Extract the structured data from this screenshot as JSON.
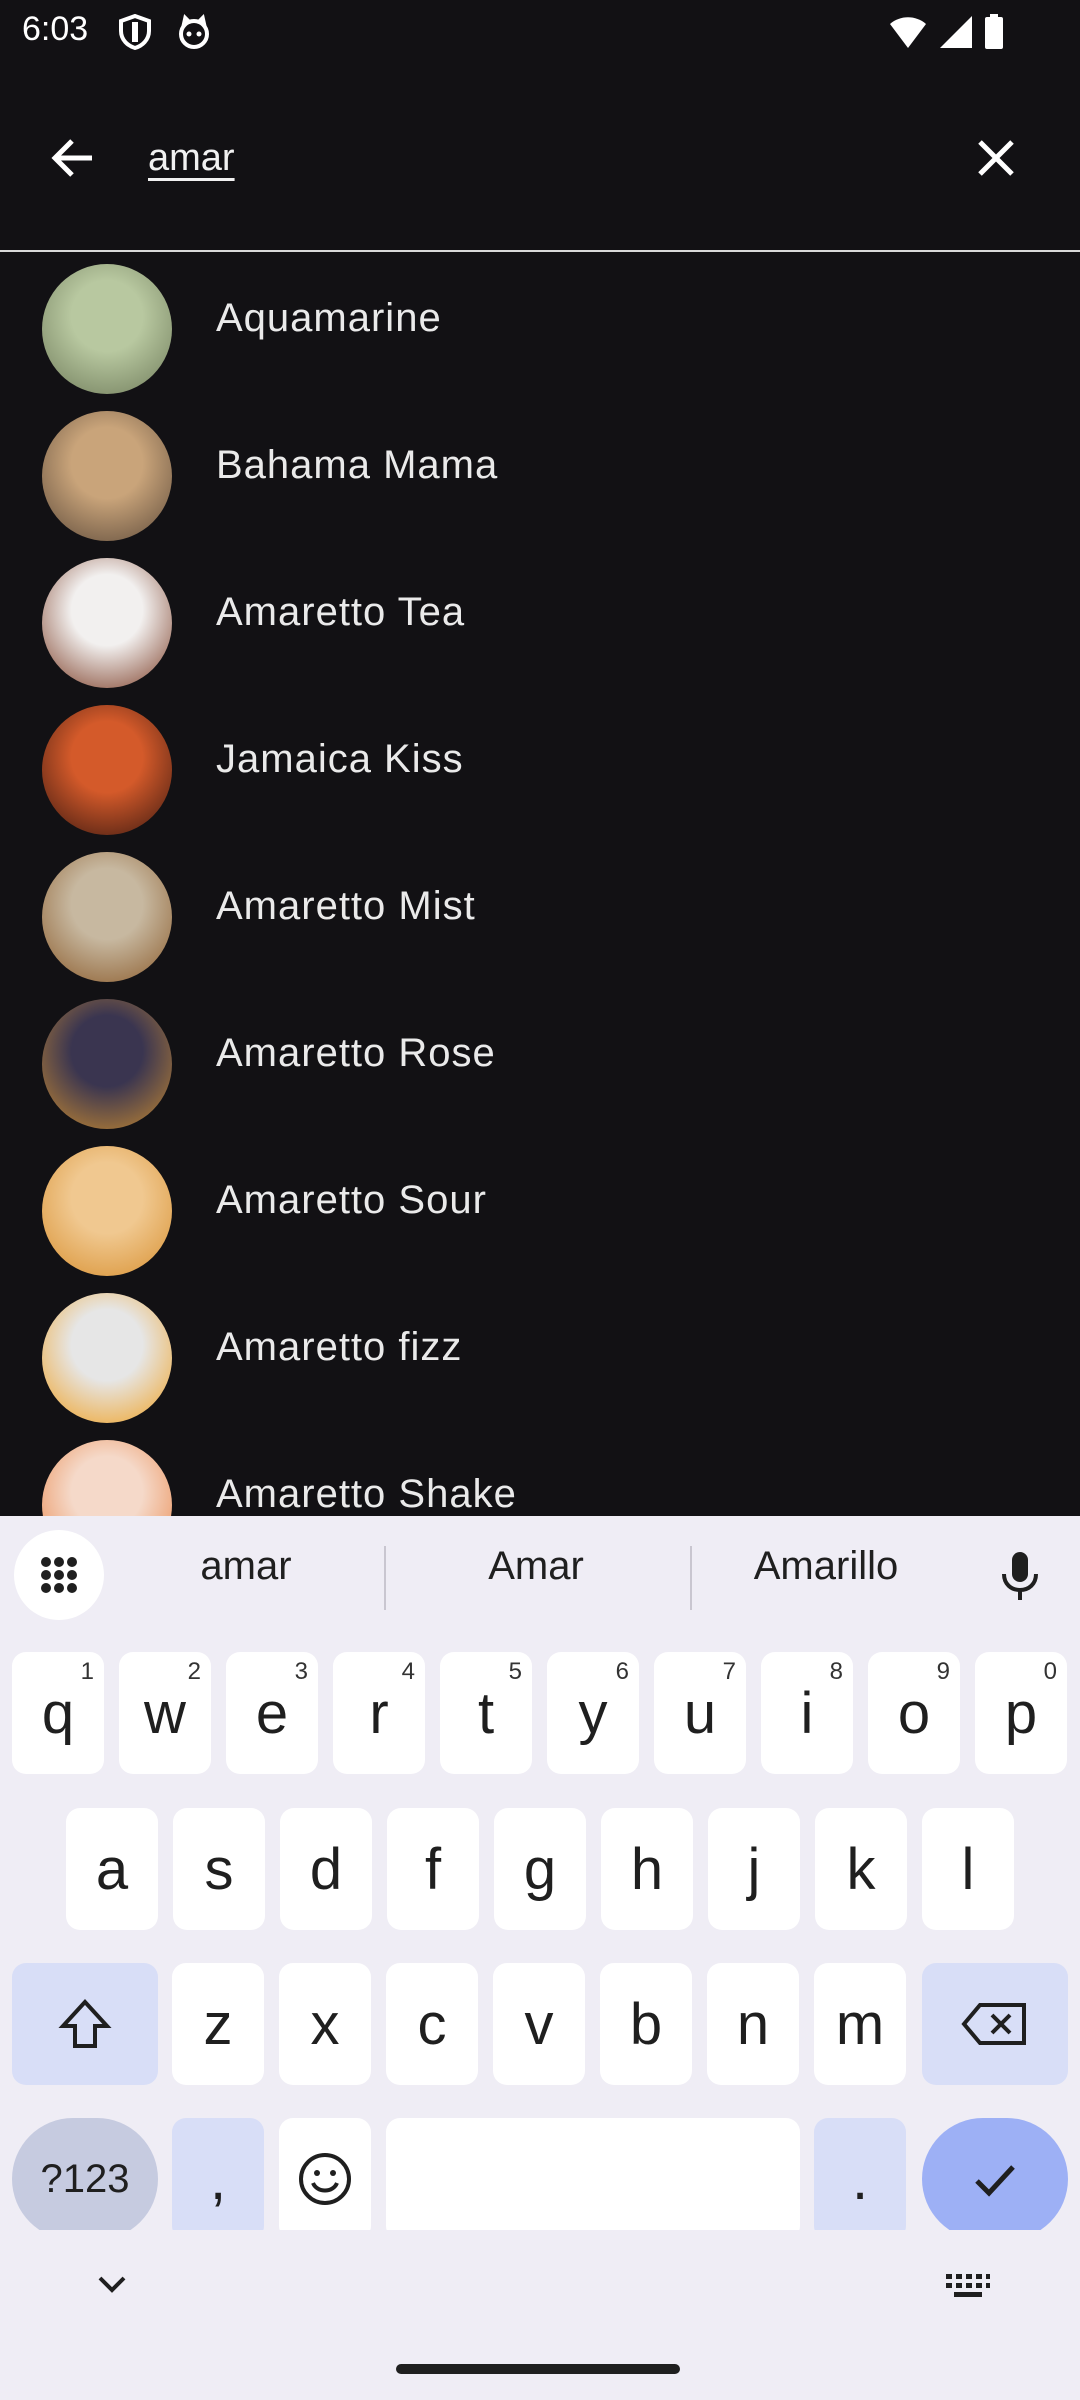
{
  "status_bar": {
    "time": "6:03",
    "icons": [
      "shield-icon",
      "cat-icon",
      "wifi-icon",
      "signal-icon",
      "battery-icon"
    ]
  },
  "search": {
    "query": "amar",
    "back_icon": "arrow-left-icon",
    "clear_icon": "close-icon"
  },
  "results": [
    {
      "name": "Aquamarine",
      "colors": [
        "#b8c8a0",
        "#6f7b5a"
      ]
    },
    {
      "name": "Bahama Mama",
      "colors": [
        "#c9a47a",
        "#5d4a3a"
      ]
    },
    {
      "name": "Amaretto Tea",
      "colors": [
        "#f2f0ef",
        "#7a3a23"
      ]
    },
    {
      "name": "Jamaica Kiss",
      "colors": [
        "#d45a2a",
        "#3a1810"
      ]
    },
    {
      "name": "Amaretto Mist",
      "colors": [
        "#c7b8a0",
        "#8a5a2a"
      ]
    },
    {
      "name": "Amaretto Rose",
      "colors": [
        "#3a3550",
        "#c78a30"
      ]
    },
    {
      "name": "Amaretto Sour",
      "colors": [
        "#f0c890",
        "#d89030"
      ]
    },
    {
      "name": "Amaretto fizz",
      "colors": [
        "#e6e6e6",
        "#f0a020"
      ]
    },
    {
      "name": "Amaretto Shake",
      "colors": [
        "#f5d9c9",
        "#e88040"
      ]
    }
  ],
  "keyboard": {
    "suggestions": [
      "amar",
      "Amar",
      "Amarillo"
    ],
    "row1": [
      {
        "k": "q",
        "h": "1"
      },
      {
        "k": "w",
        "h": "2"
      },
      {
        "k": "e",
        "h": "3"
      },
      {
        "k": "r",
        "h": "4"
      },
      {
        "k": "t",
        "h": "5"
      },
      {
        "k": "y",
        "h": "6"
      },
      {
        "k": "u",
        "h": "7"
      },
      {
        "k": "i",
        "h": "8"
      },
      {
        "k": "o",
        "h": "9"
      },
      {
        "k": "p",
        "h": "0"
      }
    ],
    "row2": [
      "a",
      "s",
      "d",
      "f",
      "g",
      "h",
      "j",
      "k",
      "l"
    ],
    "row3": [
      "z",
      "x",
      "c",
      "v",
      "b",
      "n",
      "m"
    ],
    "symbols_label": "?123",
    "comma": ",",
    "period": ".",
    "emoji_icon": "smiley-icon",
    "shift_icon": "shift-icon",
    "backspace_icon": "backspace-icon",
    "enter_icon": "check-icon",
    "colors": {
      "accent": "#9db0f5",
      "key_dark": "#d8def7",
      "key": "#ffffff",
      "panel": "#efedf5"
    }
  },
  "nav": {
    "collapse_icon": "chevron-down-icon",
    "keyboard_icon": "keyboard-icon"
  }
}
